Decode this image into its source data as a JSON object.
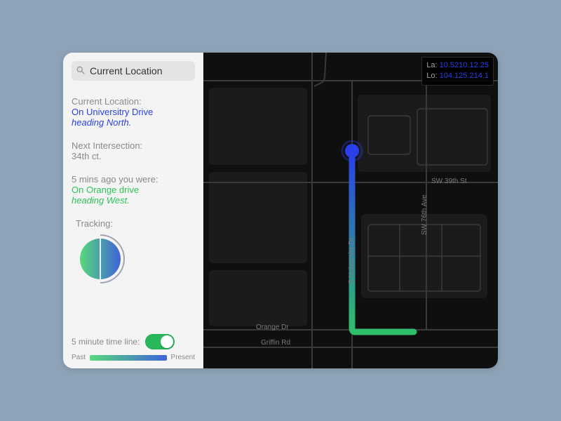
{
  "search": {
    "value": "Current Location"
  },
  "current": {
    "label": "Current Location:",
    "line1": "On Universitry Drive",
    "line2": "heading North."
  },
  "next": {
    "label": "Next Intersection:",
    "value": "34th ct."
  },
  "past": {
    "label": "5 mins ago you were:",
    "line1": "On Orange drive",
    "line2": "heading West."
  },
  "tracking_label": "Tracking:",
  "timeline": {
    "label": "5 minute time line:",
    "on": true,
    "legend_past": "Past",
    "legend_present": "Present"
  },
  "coords": {
    "lat_k": "La:",
    "lat_v": "10.5210.12.25",
    "lon_k": "Lo:",
    "lon_v": "104.125.214.1"
  },
  "map_labels": {
    "sw39": "SW 39th St",
    "sw76": "SW 76th Ave",
    "univ": "S University Dr",
    "orange": "Orange Dr",
    "griffin": "Griffin Rd"
  }
}
